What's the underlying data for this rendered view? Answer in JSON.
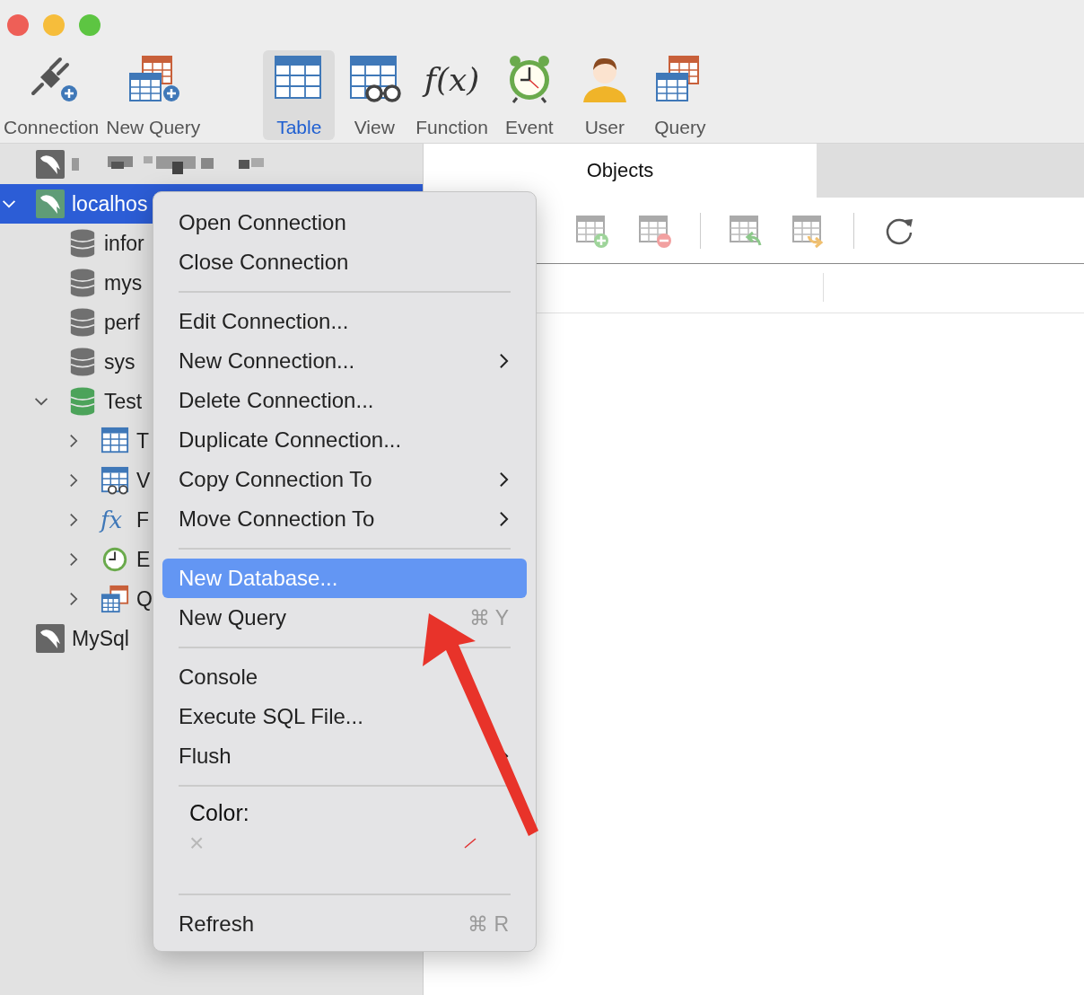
{
  "toolbar": {
    "items": [
      {
        "label": "Connection",
        "kind": "connection",
        "selected": false
      },
      {
        "label": "New Query",
        "kind": "new-query",
        "selected": false
      },
      {
        "label": "Table",
        "kind": "table",
        "selected": true
      },
      {
        "label": "View",
        "kind": "view",
        "selected": false
      },
      {
        "label": "Function",
        "kind": "function",
        "glyph": "f(x)",
        "selected": false
      },
      {
        "label": "Event",
        "kind": "event",
        "selected": false
      },
      {
        "label": "User",
        "kind": "user",
        "selected": false
      },
      {
        "label": "Query",
        "kind": "query",
        "selected": false
      }
    ]
  },
  "sidebar": {
    "items": [
      {
        "kind": "connection",
        "redacted": true,
        "open": false,
        "selected": false
      },
      {
        "kind": "connection",
        "label": "localhos",
        "open": true,
        "selected": true,
        "expanded": true,
        "children": [
          {
            "kind": "database",
            "label": "infor",
            "open": false,
            "selected": false
          },
          {
            "kind": "database",
            "label": "mys",
            "open": false,
            "selected": false
          },
          {
            "kind": "database",
            "label": "perf",
            "open": false,
            "selected": false
          },
          {
            "kind": "database",
            "label": "sys",
            "open": false,
            "selected": false
          },
          {
            "kind": "database",
            "label": "Test",
            "open": true,
            "selected": false,
            "expanded": true,
            "children": [
              {
                "kind": "tables",
                "label": "T",
                "selected": false,
                "expanded": false
              },
              {
                "kind": "views",
                "label": "V",
                "selected": false,
                "expanded": false
              },
              {
                "kind": "functions",
                "label": "F",
                "glyph": "fx",
                "selected": false,
                "expanded": false
              },
              {
                "kind": "events",
                "label": "E",
                "selected": false,
                "expanded": false
              },
              {
                "kind": "queries",
                "label": "Q",
                "selected": false,
                "expanded": false
              }
            ]
          }
        ]
      },
      {
        "kind": "connection",
        "label": "MySql",
        "open": false,
        "selected": false
      }
    ]
  },
  "tabs": [
    {
      "label": "Objects",
      "selected": true
    }
  ],
  "context_menu": {
    "items": [
      {
        "kind": "item",
        "label": "Open Connection",
        "selected": false,
        "submenu": false
      },
      {
        "kind": "item",
        "label": "Close Connection",
        "selected": false,
        "submenu": false
      },
      {
        "kind": "separator"
      },
      {
        "kind": "item",
        "label": "Edit Connection...",
        "selected": false,
        "submenu": false
      },
      {
        "kind": "item",
        "label": "New Connection...",
        "selected": false,
        "submenu": true
      },
      {
        "kind": "item",
        "label": "Delete Connection...",
        "selected": false,
        "submenu": false
      },
      {
        "kind": "item",
        "label": "Duplicate Connection...",
        "selected": false,
        "submenu": false
      },
      {
        "kind": "item",
        "label": "Copy Connection To",
        "selected": false,
        "submenu": true
      },
      {
        "kind": "item",
        "label": "Move Connection To",
        "selected": false,
        "submenu": true
      },
      {
        "kind": "separator"
      },
      {
        "kind": "item",
        "label": "New Database...",
        "selected": true,
        "submenu": false
      },
      {
        "kind": "item",
        "label": "New Query",
        "shortcut": "⌘ Y",
        "selected": false,
        "submenu": false
      },
      {
        "kind": "separator"
      },
      {
        "kind": "item",
        "label": "Console",
        "selected": false,
        "submenu": false
      },
      {
        "kind": "item",
        "label": "Execute SQL File...",
        "selected": false,
        "submenu": false
      },
      {
        "kind": "item",
        "label": "Flush",
        "selected": false,
        "submenu": true
      },
      {
        "kind": "separator"
      },
      {
        "kind": "color",
        "label": "Color:",
        "none_glyph": "×"
      },
      {
        "kind": "separator"
      },
      {
        "kind": "item",
        "label": "Refresh",
        "shortcut": "⌘ R",
        "selected": false,
        "submenu": false
      }
    ]
  }
}
